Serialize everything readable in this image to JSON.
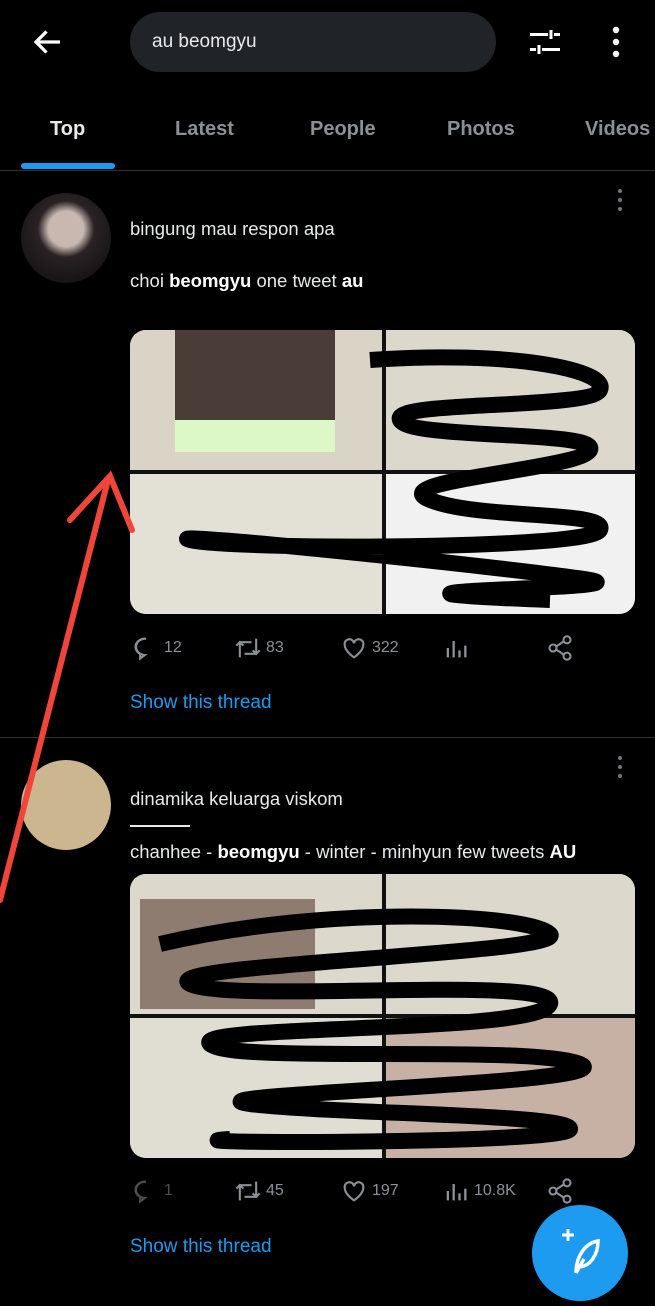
{
  "search": {
    "query": "au beomgyu"
  },
  "icons": {
    "back": "arrow-left-icon",
    "filter": "sliders-icon",
    "more": "more-vertical-icon",
    "compose": "feather-plus-icon"
  },
  "tabs": [
    {
      "label": "Top",
      "active": true
    },
    {
      "label": "Latest"
    },
    {
      "label": "People"
    },
    {
      "label": "Photos"
    },
    {
      "label": "Videos"
    }
  ],
  "colors": {
    "accent": "#1d9bf0",
    "background": "#000000",
    "annotation_arrow": "#f0463a"
  },
  "tweets": [
    {
      "line1": "bingung mau respon apa",
      "line2": [
        {
          "text": "choi ",
          "bold": false
        },
        {
          "text": "beomgyu",
          "bold": true
        },
        {
          "text": " one tweet ",
          "bold": false
        },
        {
          "text": "au",
          "bold": true
        }
      ],
      "replies": "12",
      "retweets": "83",
      "likes": "322",
      "views": "",
      "show_thread": "Show this thread"
    },
    {
      "line1": "dinamika keluarga viskom",
      "line2": [
        {
          "text": "chanhee - ",
          "bold": false
        },
        {
          "text": "beomgyu",
          "bold": true
        },
        {
          "text": " - winter - minhyun few tweets ",
          "bold": false
        },
        {
          "text": "AU",
          "bold": true
        }
      ],
      "replies": "1",
      "retweets": "45",
      "likes": "197",
      "views": "10.8K",
      "show_thread": "Show this thread"
    }
  ]
}
